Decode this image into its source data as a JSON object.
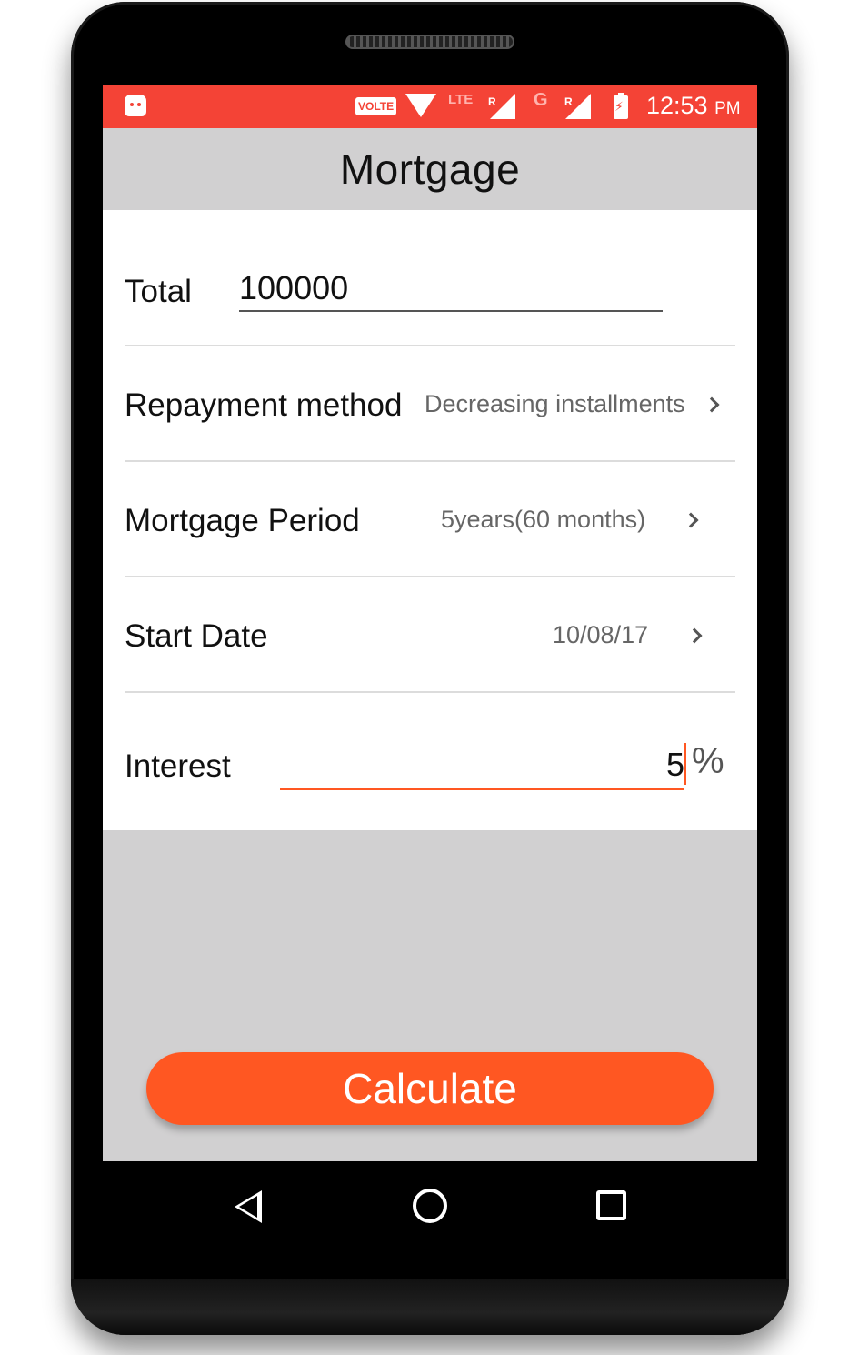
{
  "status_bar": {
    "volte": "VOLTE",
    "net1": "LTE",
    "net1_roaming": "R",
    "net2": "G",
    "net2_roaming": "R",
    "time": "12:53",
    "ampm": "PM"
  },
  "app_bar": {
    "title": "Mortgage"
  },
  "form": {
    "total": {
      "label": "Total",
      "value": "100000"
    },
    "repayment": {
      "label": "Repayment method",
      "value": "Decreasing installments"
    },
    "period": {
      "label": "Mortgage Period",
      "value": "5years(60 months)"
    },
    "start_date": {
      "label": "Start Date",
      "value": "10/08/17"
    },
    "interest": {
      "label": "Interest",
      "value": "5",
      "unit": "%"
    }
  },
  "calculate_button": {
    "label": "Calculate"
  },
  "colors": {
    "status_bar": "#f44336",
    "accent": "#ff5722",
    "background": "#d1d0d1"
  },
  "nav": {
    "back": "back-icon",
    "home": "home-icon",
    "recents": "recents-icon"
  }
}
